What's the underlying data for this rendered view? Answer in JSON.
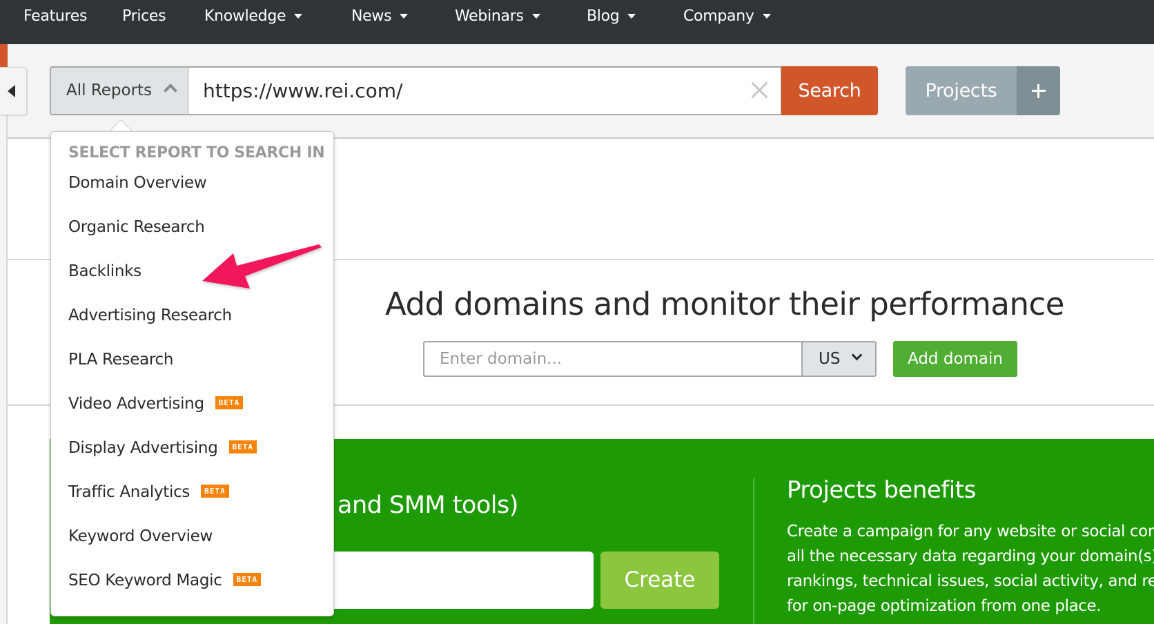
{
  "nav": {
    "items": [
      {
        "label": "Features",
        "dropdown": false
      },
      {
        "label": "Prices",
        "dropdown": false
      },
      {
        "label": "Knowledge",
        "dropdown": true
      },
      {
        "label": "News",
        "dropdown": true
      },
      {
        "label": "Webinars",
        "dropdown": true
      },
      {
        "label": "Blog",
        "dropdown": true
      },
      {
        "label": "Company",
        "dropdown": true
      }
    ]
  },
  "search": {
    "report_select_label": "All Reports",
    "url_value": "https://www.rei.com/",
    "search_label": "Search",
    "projects_label": "Projects"
  },
  "dropdown": {
    "title": "SELECT REPORT TO SEARCH IN",
    "items": [
      {
        "label": "Domain Overview",
        "badge": ""
      },
      {
        "label": "Organic Research",
        "badge": ""
      },
      {
        "label": "Backlinks",
        "badge": ""
      },
      {
        "label": "Advertising Research",
        "badge": ""
      },
      {
        "label": "PLA Research",
        "badge": ""
      },
      {
        "label": "Video Advertising",
        "badge": "BETA"
      },
      {
        "label": "Display Advertising",
        "badge": "BETA"
      },
      {
        "label": "Traffic Analytics",
        "badge": "BETA"
      },
      {
        "label": "Keyword Overview",
        "badge": ""
      },
      {
        "label": "SEO Keyword Magic",
        "badge": "BETA"
      }
    ]
  },
  "domains": {
    "heading": "Add domains and monitor their performance",
    "input_placeholder": "Enter domain...",
    "country": "US",
    "add_label": "Add domain"
  },
  "project_panel": {
    "title_fragment": "and SMM tools)",
    "create_label": "Create",
    "benefits_title": "Projects benefits",
    "benefits_lines": [
      "Create a campaign for any website or social comm",
      "all the necessary data regarding your domain(s)’ k",
      "rankings, technical issues, social activity, and reco",
      "for on-page optimization from one place."
    ]
  },
  "colors": {
    "nav_bg": "#2f3439",
    "brand_orange": "#d1572b",
    "projects_gray": "#9aa9b0",
    "add_green": "#4fae33",
    "panel_green": "#1e9b04",
    "create_green": "#8cc63f",
    "beta_orange": "#f7830a",
    "annotation_pink": "#f2185a"
  }
}
